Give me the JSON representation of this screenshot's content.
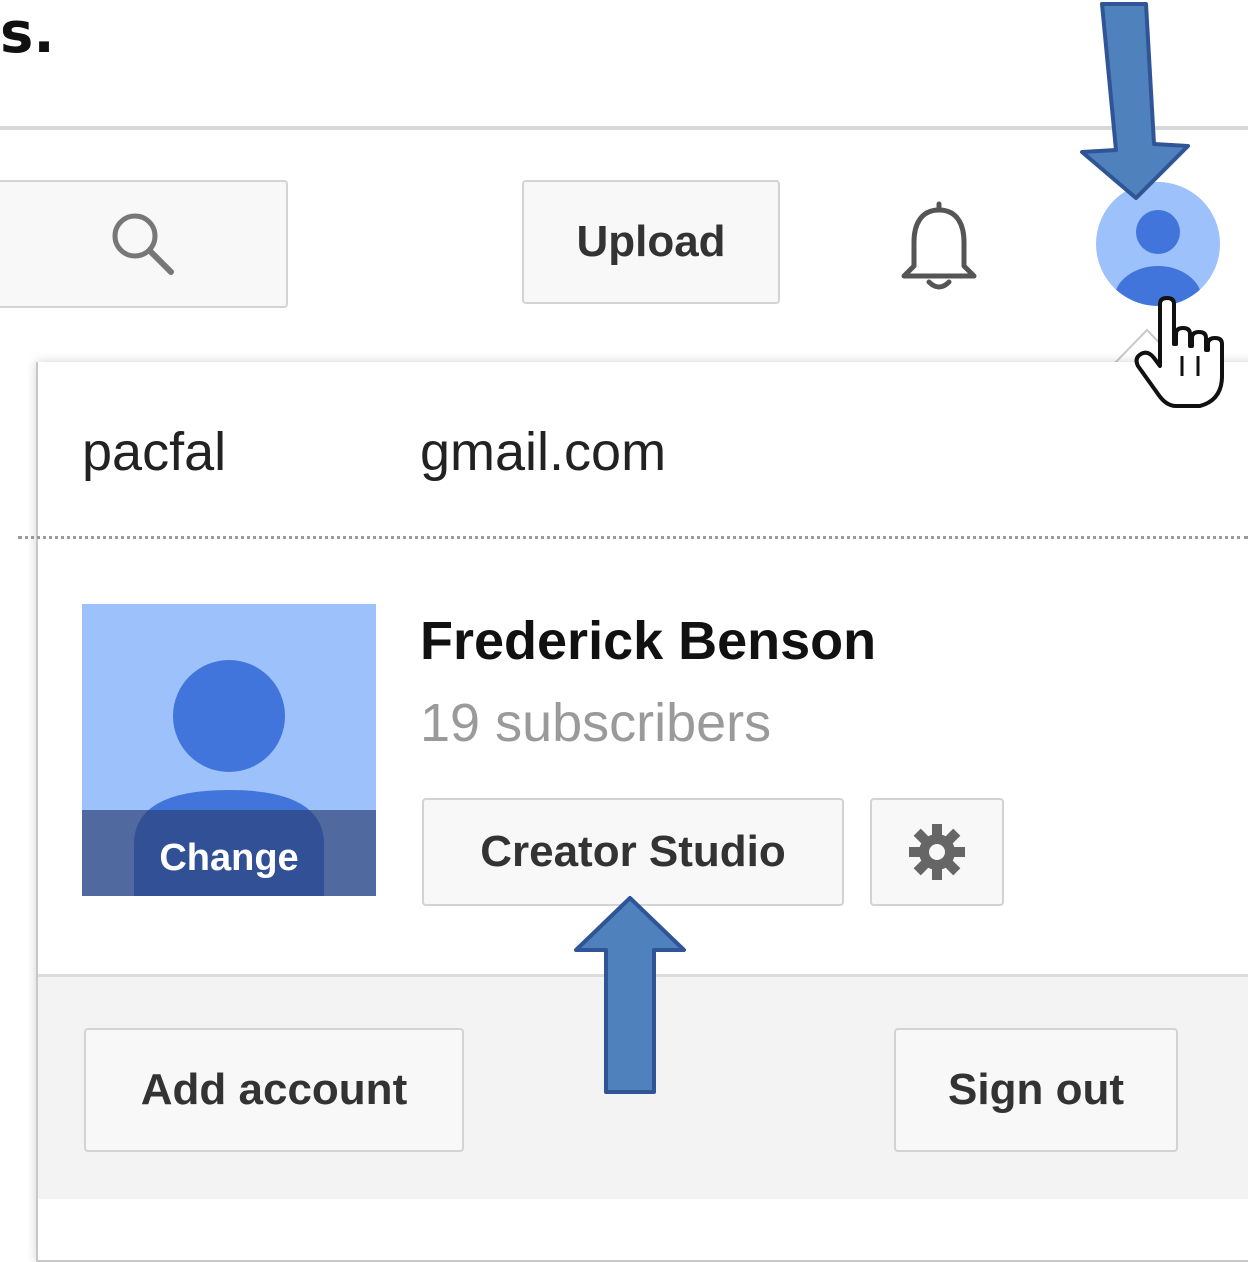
{
  "heading": {
    "fragment": "s."
  },
  "masthead": {
    "search_icon": "search-icon",
    "upload_label": "Upload",
    "bell_icon": "bell-icon",
    "avatar_icon": "account-avatar-icon"
  },
  "account_menu": {
    "email_user": "pacfal",
    "email_domain": "gmail.com",
    "channel_name": "Frederick Benson",
    "subscribers": "19 subscribers",
    "change_label": "Change",
    "creator_studio_label": "Creator Studio",
    "settings_icon": "gear-icon",
    "add_account_label": "Add account",
    "sign_out_label": "Sign out"
  },
  "colors": {
    "arrow_fill": "#4f81bd",
    "arrow_stroke": "#2f5597",
    "avatar_light": "#9cc1fb",
    "avatar_dark": "#4275dc"
  }
}
